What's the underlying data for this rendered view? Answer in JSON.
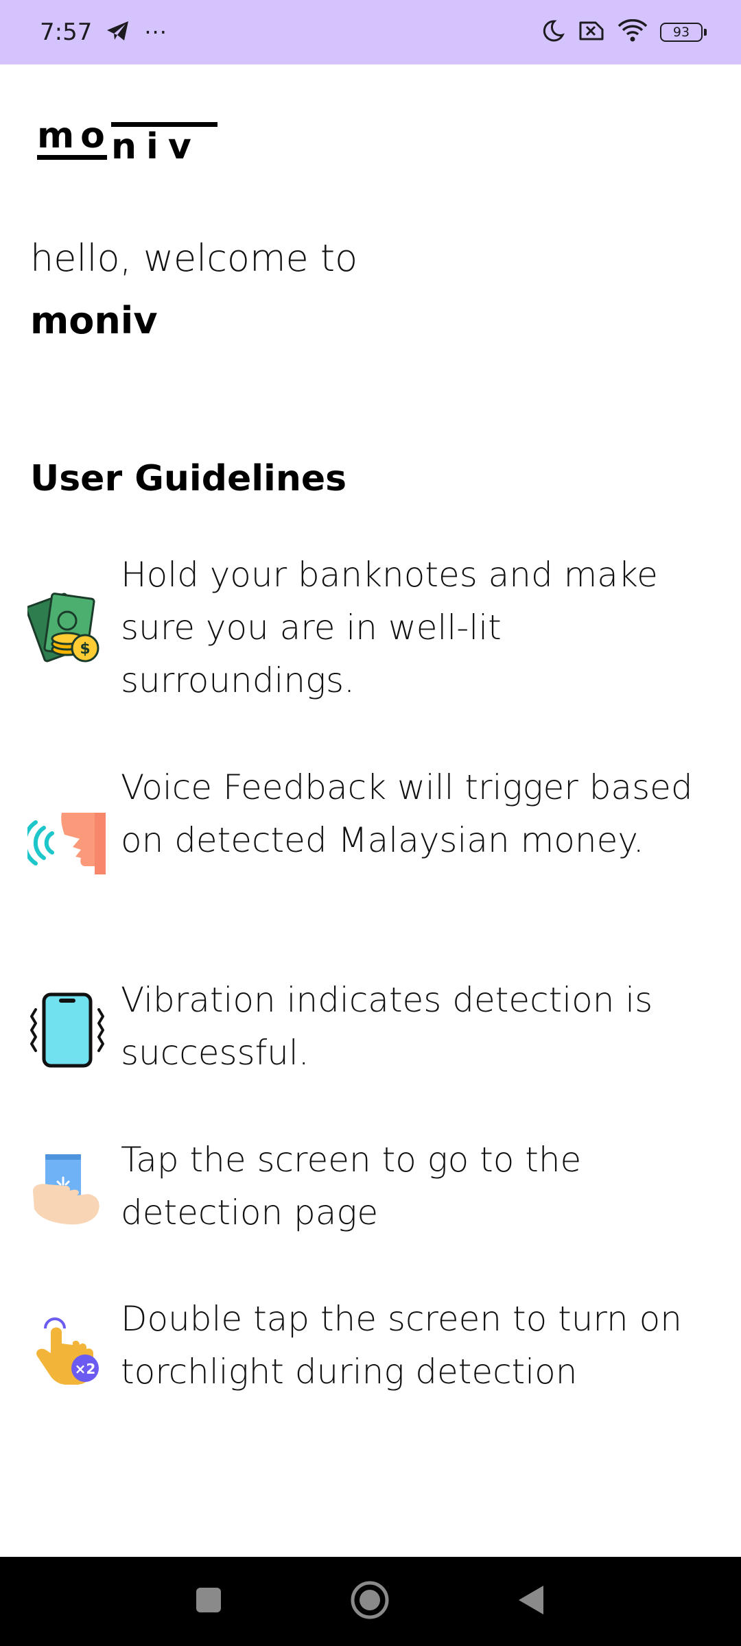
{
  "status_bar": {
    "time": "7:57",
    "overflow_dots": "···",
    "battery": "93",
    "icons": [
      "telegram-icon",
      "more-dots-icon",
      "moon-icon",
      "sim-off-icon",
      "wifi-icon",
      "battery-icon"
    ]
  },
  "logo": {
    "top_text": "mo",
    "bottom_text": "niv"
  },
  "welcome": {
    "line1": "hello, welcome to",
    "app_name": "moniv"
  },
  "guidelines": {
    "heading": "User Guidelines",
    "items": [
      {
        "icon": "money-icon",
        "text": "Hold your banknotes and make sure you are in well-lit surroundings."
      },
      {
        "icon": "voice-icon",
        "text": "Voice Feedback will trigger based on detected Malaysian money."
      },
      {
        "icon": "vibration-icon",
        "text": "Vibration indicates detection is successful."
      },
      {
        "icon": "tap-phone-icon",
        "text": "Tap the screen to go to the detection page"
      },
      {
        "icon": "double-tap-icon",
        "text": "Double tap the screen to turn on torchlight during detection",
        "badge": "×2"
      }
    ]
  },
  "nav_bar": {
    "icons": [
      "recents-icon",
      "home-icon",
      "back-icon"
    ]
  },
  "colors": {
    "status_bar": "#d4c3fc",
    "nav_bar": "#000000",
    "text": "#111111"
  }
}
